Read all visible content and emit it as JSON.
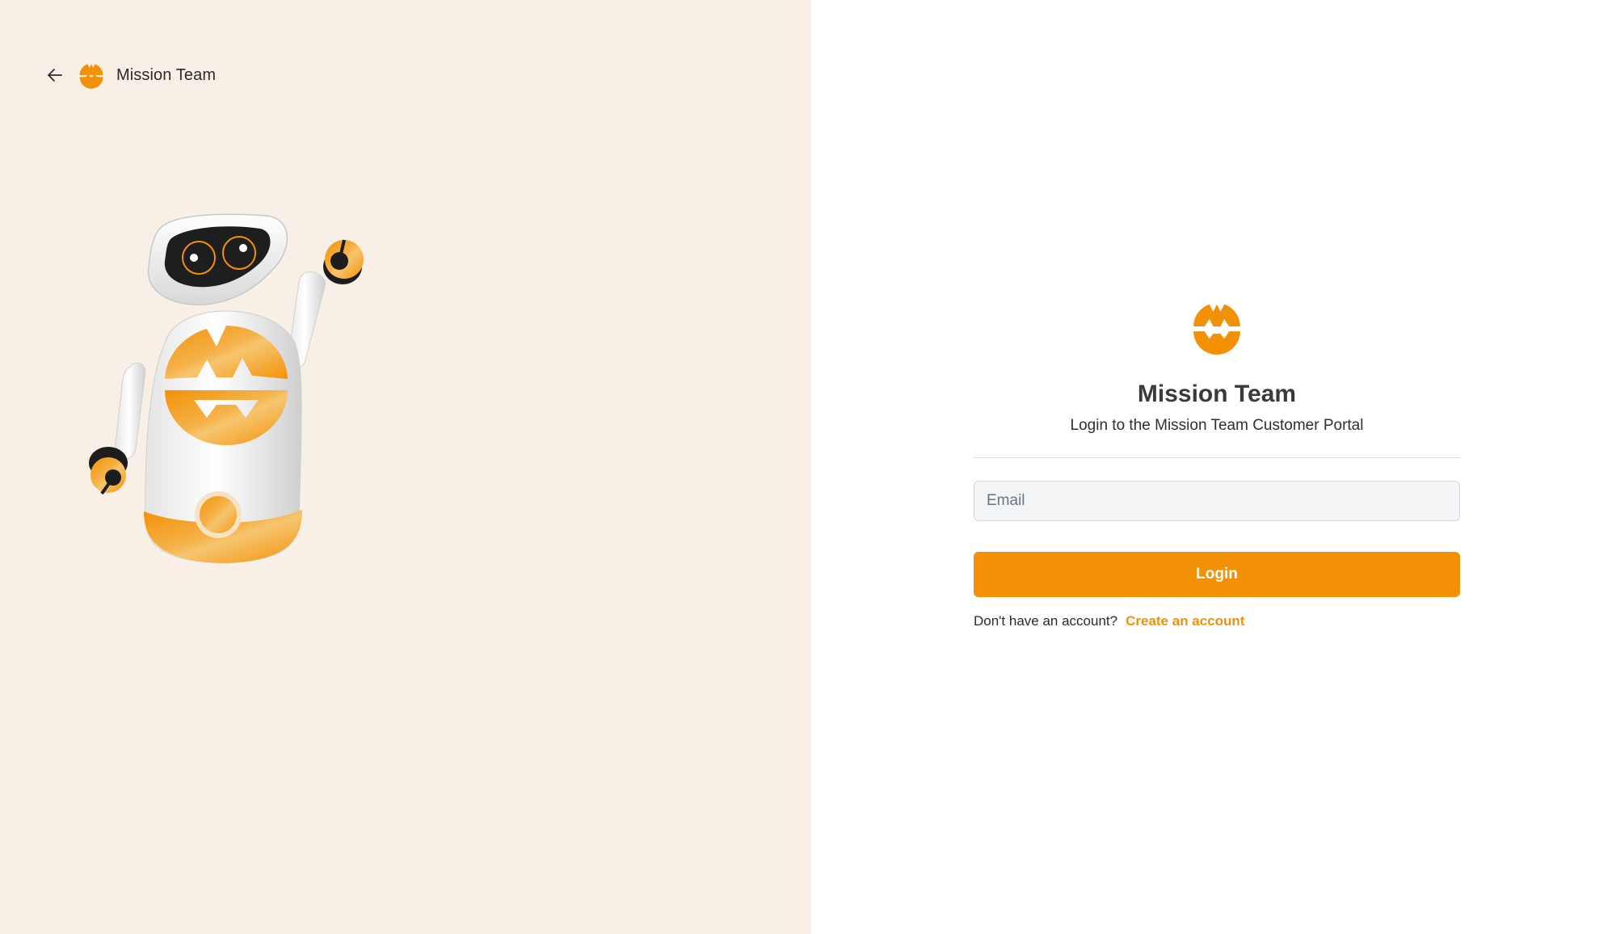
{
  "brand": {
    "name": "Mission Team",
    "accent_color": "#f29106",
    "logo_icon": "mission-team-logo-icon"
  },
  "nav": {
    "back_icon": "arrow-left-icon"
  },
  "illustration": {
    "icon": "robot-mascot-illustration"
  },
  "login": {
    "title": "Mission Team",
    "subtitle": "Login to the Mission Team Customer Portal",
    "email_placeholder": "Email",
    "email_value": "",
    "button_label": "Login",
    "no_account_text": "Don't have an account?",
    "create_account_link": "Create an account"
  },
  "colors": {
    "left_background": "#f8f0e6",
    "right_background": "#ffffff",
    "input_background": "#f3f4f6"
  }
}
